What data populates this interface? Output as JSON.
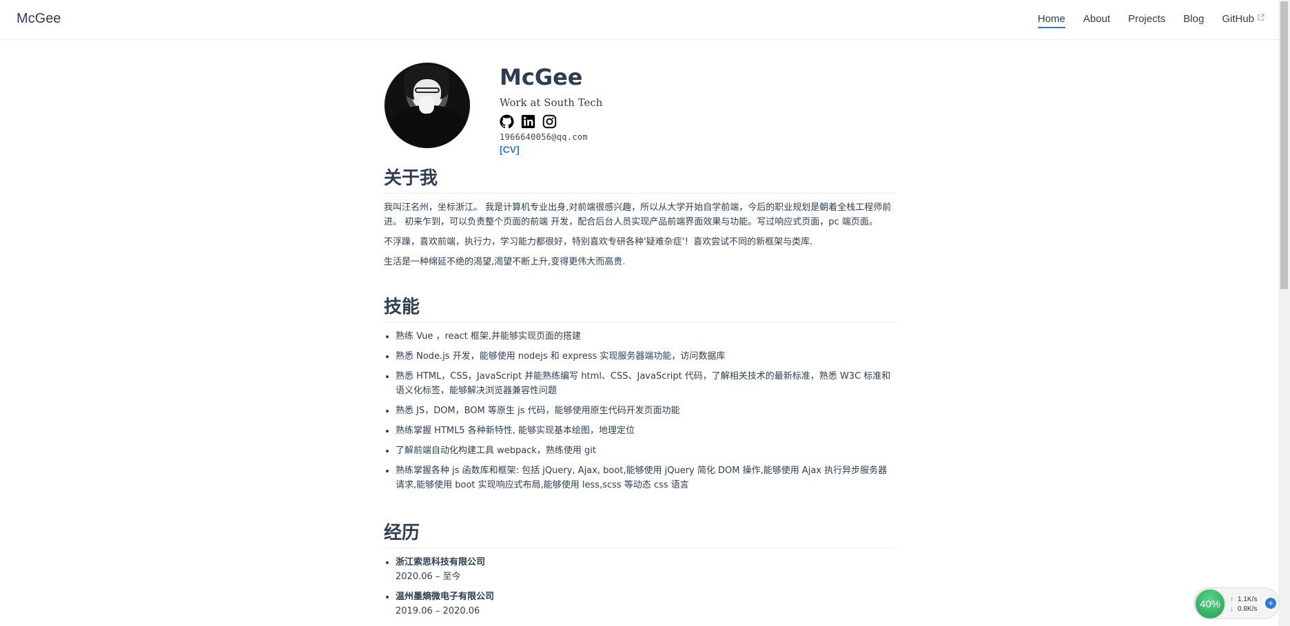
{
  "nav": {
    "site_name": "McGee",
    "links": [
      "Home",
      "About",
      "Projects",
      "Blog",
      "GitHub"
    ],
    "active": "Home"
  },
  "profile": {
    "name": "McGee",
    "work": "Work at South Tech",
    "social_icons": [
      "github-icon",
      "linkedin-icon",
      "instagram-icon"
    ],
    "email": "1966640056@qq.com",
    "cv_label": "[CV]"
  },
  "about": {
    "heading": "关于我",
    "paragraphs": [
      "我叫汪名州，坐标浙江。 我是计算机专业出身,对前端很感兴趣，所以从大学开始自学前端，今后的职业规划是朝着全栈工程师前进。 初来乍到，可以负责整个页面的前端 开发，配合后台人员实现产品前端界面效果与功能。写过响应式页面，pc 端页面。",
      "不浮躁，喜欢前端，执行力，学习能力都很好，特别喜欢专研各种'疑难杂症'！喜欢尝试不同的新框架与类库.",
      "生活是一种绵延不绝的渴望,渴望不断上升,变得更伟大而高贵."
    ]
  },
  "skills": {
    "heading": "技能",
    "items": [
      "熟练 Vue ，react 框架,并能够实现页面的搭建",
      "熟悉 Node.js 开发，能够使用 nodejs 和 express 实现服务器端功能，访问数据库",
      "熟悉 HTML，CSS，JavaScript 并能熟练编写 html、CSS、JavaScript 代码，了解相关技术的最新标准，熟悉 W3C 标准和语义化标签，能够解决浏览器兼容性问题",
      "熟悉 JS，DOM，BOM 等原生 js 代码，能够使用原生代码开发页面功能",
      "熟练掌握 HTML5 各种新特性, 能够实现基本绘图，地理定位",
      "了解前端自动化构建工具 webpack，熟练使用 git",
      "熟练掌握各种 js 函数库和框架: 包括 jQuery, Ajax, boot,能够使用 jQuery 简化 DOM 操作,能够使用 Ajax 执行异步服务器请求,能够使用 boot 实现响应式布局,能够使用 less,scss 等动态 css 语言"
    ]
  },
  "experience": {
    "heading": "经历",
    "jobs": [
      {
        "company": "浙江索思科技有限公司",
        "period": "2020.06 – 至今"
      },
      {
        "company": "温州墨熵微电子有限公司",
        "period": "2019.06 – 2020.06"
      }
    ]
  },
  "net_monitor": {
    "percent": "40%",
    "upload": "1.1K/s",
    "download": "0.8K/s",
    "colors": {
      "ring": "#1e9e4e",
      "up": "#e4393c",
      "down": "#2c9e4a",
      "plus": "#2f7bd4"
    }
  },
  "colors": {
    "accent": "#2f7bd4",
    "text": "#2c3e50",
    "border": "#eaecef"
  }
}
